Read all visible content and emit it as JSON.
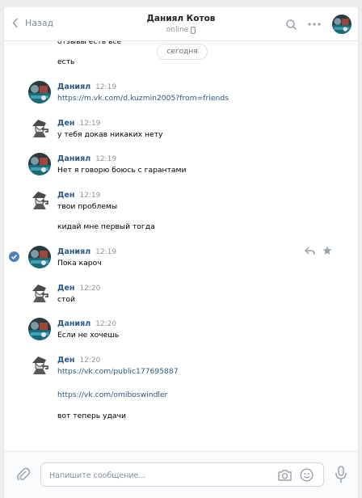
{
  "header": {
    "back_label": "Назад",
    "peer_name": "Даниял Котов",
    "peer_status": "online"
  },
  "date_divider": "сегодня",
  "messages": [
    {
      "text": "отзывы есть все"
    },
    {
      "text": "есть"
    },
    {
      "author": "Даниял",
      "time": "12:19",
      "text": "https://m.vk.com/d.kuzmin2005?from=friends",
      "is_link": true
    },
    {
      "author": "Ден",
      "time": "12:19",
      "text": "у тебя докав никаких нету"
    },
    {
      "author": "Даниял",
      "time": "12:19",
      "text": "Нет я говорю боюсь с гарантами"
    },
    {
      "author": "Ден",
      "time": "12:19",
      "text": "твои проблемы"
    },
    {
      "text": "кидай мне первый тогда"
    },
    {
      "author": "Даниял",
      "time": "12:19",
      "text": "Пока кароч"
    },
    {
      "author": "Ден",
      "time": "12:20",
      "text": "стой"
    },
    {
      "author": "Даниял",
      "time": "12:20",
      "text": "Если не хочешь"
    },
    {
      "author": "Ден",
      "time": "12:20",
      "text": "https://vk.com/public177695887",
      "is_link": true
    },
    {
      "text": "https://vk.com/omiboswindler",
      "is_link": true
    },
    {
      "text": "вот теперь удачи"
    }
  ],
  "composer": {
    "placeholder": "Напишите сообщение..."
  },
  "icons": {
    "back": "chevron-left-icon",
    "search": "search-icon",
    "more": "more-icon",
    "phone": "mobile-icon",
    "reply": "reply-icon",
    "favorite": "star-icon",
    "selected": "check-circle-icon",
    "attach": "paperclip-icon",
    "camera": "camera-icon",
    "emoji": "smile-icon",
    "mic": "microphone-icon"
  },
  "colors": {
    "link": "#2a5885",
    "secondary": "#939393",
    "background": "#edeef0",
    "check": "#5181b8"
  }
}
